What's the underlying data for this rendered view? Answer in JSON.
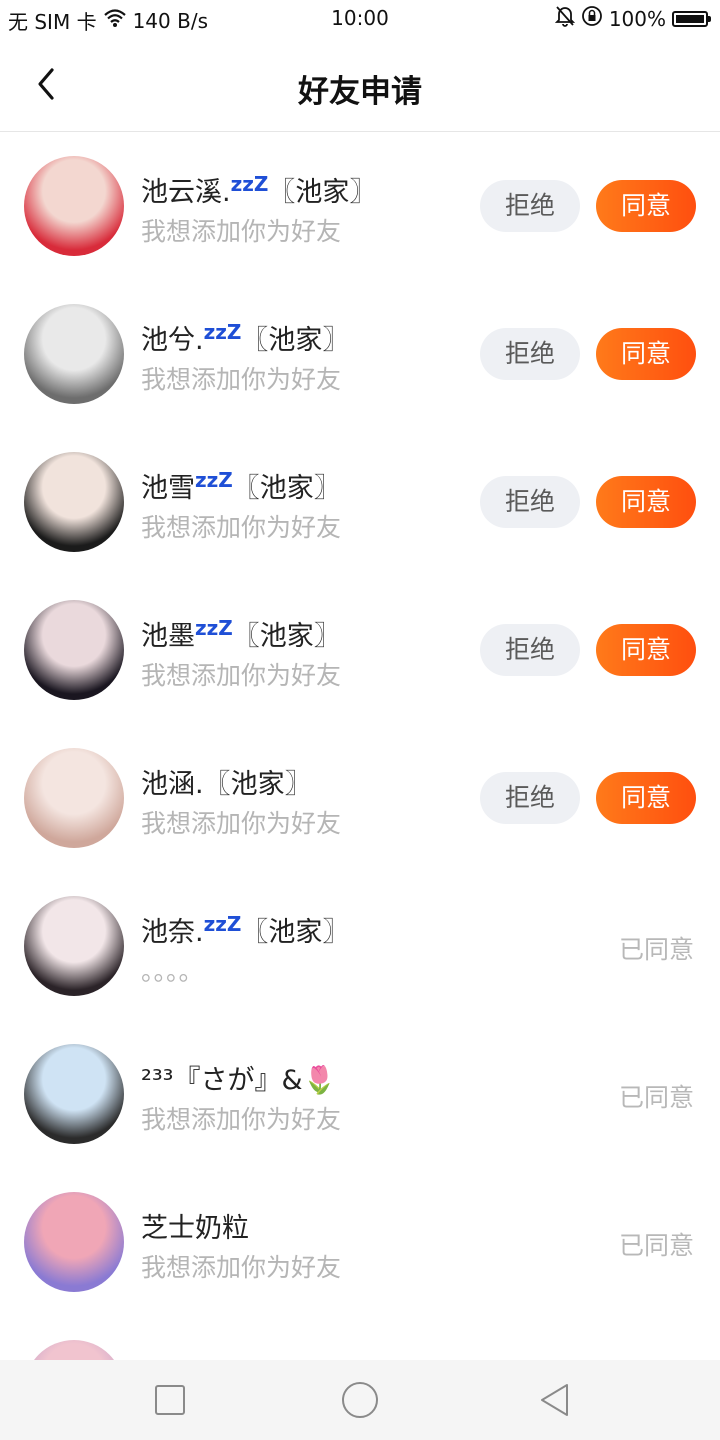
{
  "status_bar": {
    "carrier": "无 SIM 卡",
    "speed": "140 B/s",
    "time": "10:00",
    "battery": "100%",
    "battery_level": 1.0
  },
  "header": {
    "title": "好友申请"
  },
  "colors": {
    "accent": "#ff5a14",
    "zzz": "#1f4fd6"
  },
  "requests": [
    {
      "name": "池云溪.",
      "zzz": "zzZ",
      "suffix": "〖池家〗",
      "message": "我想添加你为好友",
      "reject_label": "拒绝",
      "accept_label": "同意",
      "avatar_colors": [
        "#f3d7d0",
        "#d82b3a"
      ]
    },
    {
      "name": "池兮.",
      "zzz": "zzZ",
      "suffix": "〖池家〗",
      "message": "我想添加你为好友",
      "reject_label": "拒绝",
      "accept_label": "同意",
      "avatar_colors": [
        "#e9e9e9",
        "#6d6d6d"
      ]
    },
    {
      "name": "池雪",
      "zzz": "zzZ",
      "suffix": "〖池家〗",
      "message": "我想添加你为好友",
      "reject_label": "拒绝",
      "accept_label": "同意",
      "avatar_colors": [
        "#f1e3dc",
        "#1b1b1b"
      ]
    },
    {
      "name": "池墨",
      "zzz": "zzZ",
      "suffix": "〖池家〗",
      "message": "我想添加你为好友",
      "reject_label": "拒绝",
      "accept_label": "同意",
      "avatar_colors": [
        "#ead9dc",
        "#1a1620"
      ]
    },
    {
      "name": "池涵.",
      "zzz": "",
      "suffix": "〖池家〗",
      "message": "我想添加你为好友",
      "reject_label": "拒绝",
      "accept_label": "同意",
      "avatar_colors": [
        "#f4e5e0",
        "#cfa79b"
      ]
    },
    {
      "name": "池奈.",
      "zzz": "zzZ",
      "suffix": "〖池家〗",
      "message": "。。。。",
      "status": "已同意",
      "avatar_colors": [
        "#f2e6e8",
        "#2b2328"
      ]
    },
    {
      "name": "²³³『さが』&🌷",
      "zzz": "",
      "suffix": "",
      "message": "我想添加你为好友",
      "status": "已同意",
      "avatar_colors": [
        "#cfe3f4",
        "#2b2b2b"
      ]
    },
    {
      "name": "芝士奶粒",
      "zzz": "",
      "suffix": "",
      "message": "我想添加你为好友",
      "status": "已同意",
      "avatar_colors": [
        "#f0a6b6",
        "#8a7ad3"
      ]
    },
    {
      "name": "",
      "zzz": "",
      "suffix": "",
      "message": "",
      "status": "",
      "avatar_colors": [
        "#f1c4cf",
        "#c7a1c9"
      ]
    }
  ],
  "nav": {
    "icons": [
      "square-icon",
      "circle-icon",
      "triangle-back-icon"
    ]
  }
}
